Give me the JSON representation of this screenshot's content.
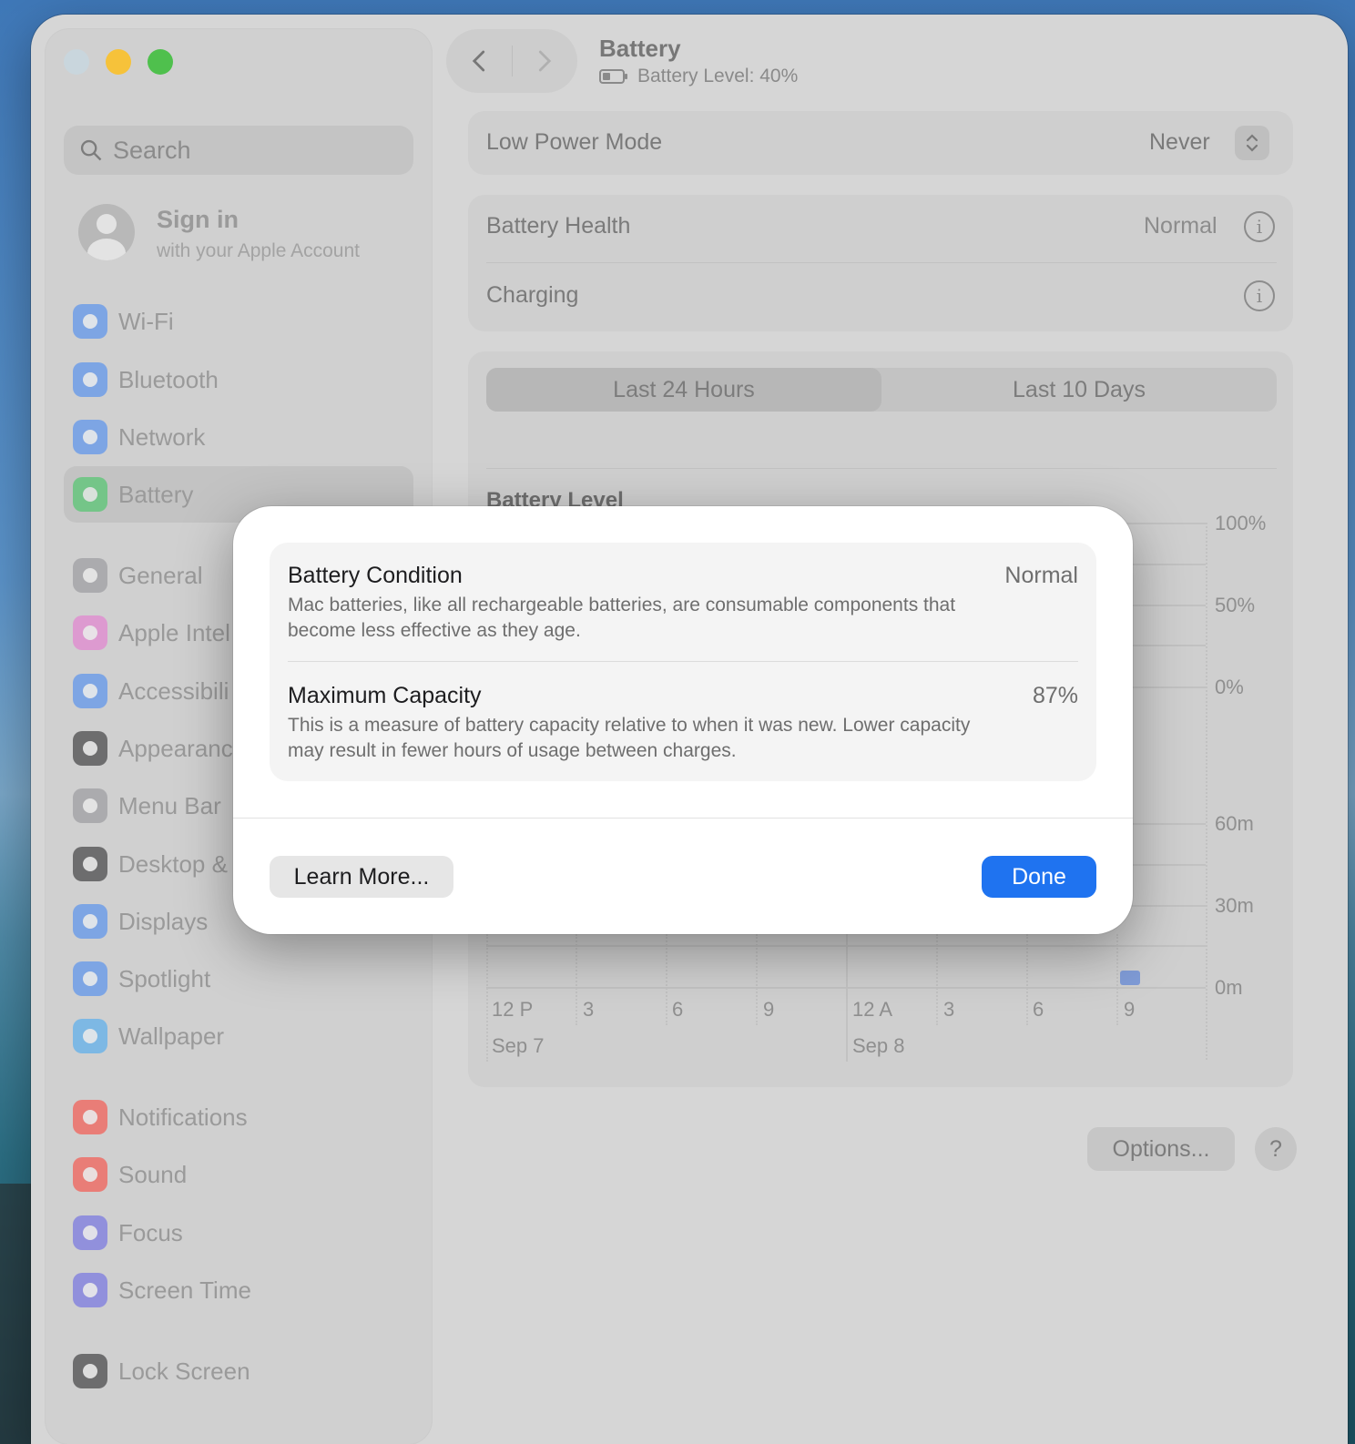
{
  "window": {
    "title": "Battery",
    "subtitle": "Battery Level: 40%"
  },
  "sidebar": {
    "search_placeholder": "Search",
    "account": {
      "title": "Sign in",
      "subtitle": "with your Apple Account"
    },
    "items": [
      {
        "label": "Wi-Fi",
        "icon": "wifi-icon",
        "color": "#3b82f6"
      },
      {
        "label": "Bluetooth",
        "icon": "bluetooth-icon",
        "color": "#3b82f6"
      },
      {
        "label": "Network",
        "icon": "globe-icon",
        "color": "#3b82f6"
      },
      {
        "label": "Battery",
        "icon": "battery-icon",
        "color": "#34c759",
        "active": true
      },
      {
        "label": "General",
        "icon": "gear-icon",
        "color": "#8e8e93"
      },
      {
        "label": "Apple Intel",
        "icon": "apple-intelligence-icon",
        "color": "#e86fd1"
      },
      {
        "label": "Accessibili",
        "icon": "accessibility-icon",
        "color": "#3b82f6"
      },
      {
        "label": "Appearanc",
        "icon": "appearance-icon",
        "color": "#1d1d1f"
      },
      {
        "label": "Menu Bar",
        "icon": "menu-bar-icon",
        "color": "#8e8e93"
      },
      {
        "label": "Desktop &",
        "icon": "desktop-icon",
        "color": "#1d1d1f"
      },
      {
        "label": "Displays",
        "icon": "sun-icon",
        "color": "#3b82f6"
      },
      {
        "label": "Spotlight",
        "icon": "magnifier-icon",
        "color": "#3b82f6"
      },
      {
        "label": "Wallpaper",
        "icon": "flower-icon",
        "color": "#3ba6f6"
      },
      {
        "label": "Notifications",
        "icon": "bell-icon",
        "color": "#ff3b30"
      },
      {
        "label": "Sound",
        "icon": "speaker-icon",
        "color": "#ff3b30"
      },
      {
        "label": "Focus",
        "icon": "moon-icon",
        "color": "#5e5ce6"
      },
      {
        "label": "Screen Time",
        "icon": "hourglass-icon",
        "color": "#5e5ce6"
      },
      {
        "label": "Lock Screen",
        "icon": "lock-icon",
        "color": "#1d1d1f"
      }
    ]
  },
  "settings": {
    "low_power_label": "Low Power Mode",
    "low_power_value": "Never",
    "health_label": "Battery Health",
    "health_value": "Normal",
    "charging_label": "Charging",
    "tabs": [
      "Last 24 Hours",
      "Last 10 Days"
    ],
    "chart_title": "Battery Level",
    "y_level_ticks": [
      "100%",
      "50%",
      "0%"
    ],
    "y_usage_ticks": [
      "60m",
      "30m",
      "0m"
    ],
    "x_ticks": [
      "12 P",
      "3",
      "6",
      "9",
      "12 A",
      "3",
      "6",
      "9"
    ],
    "dates": [
      "Sep 7",
      "Sep 8"
    ],
    "options_label": "Options...",
    "help_label": "?"
  },
  "dialog": {
    "condition_title": "Battery Condition",
    "condition_value": "Normal",
    "condition_desc": "Mac batteries, like all rechargeable batteries, are consumable components that become less effective as they age.",
    "capacity_title": "Maximum Capacity",
    "capacity_value": "87%",
    "capacity_desc": "This is a measure of battery capacity relative to when it was new. Lower capacity may result in fewer hours of usage between charges.",
    "learn_more": "Learn More...",
    "done": "Done"
  },
  "colors": {
    "accent": "#1f73f0"
  }
}
